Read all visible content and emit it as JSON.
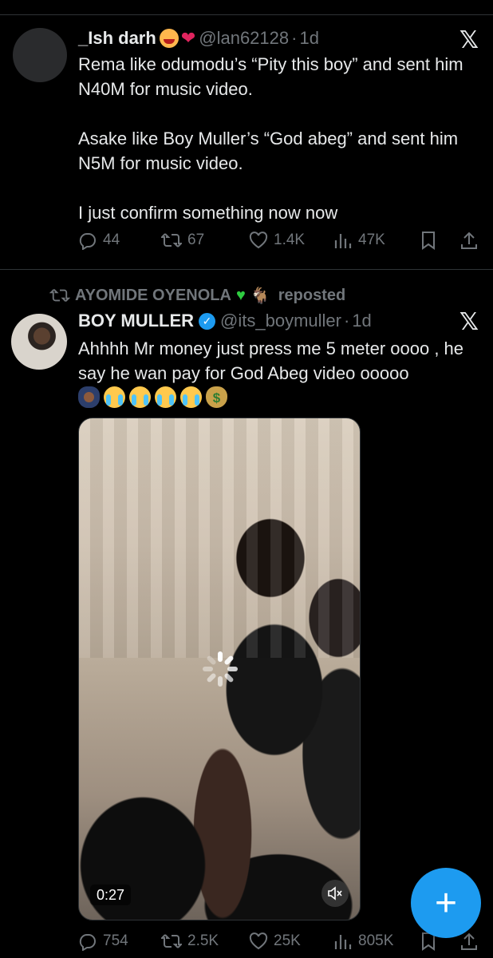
{
  "tweet1": {
    "display_name": "_Ish darh",
    "handle": "@lan62128",
    "separator": "·",
    "age": "1d",
    "x_logo": "𝕏",
    "paragraphs": [
      "Rema like odumodu’s “Pity this boy” and sent him N40M for music video.",
      "Asake like Boy Muller’s “God abeg” and sent him N5M for music video.",
      "I just confirm something now now"
    ],
    "stats": {
      "replies": "44",
      "reposts": "67",
      "likes": "1.4K",
      "views": "47K"
    }
  },
  "tweet2": {
    "repost_by": "AYOMIDE OYENOLA",
    "repost_emoji": "🐐",
    "repost_label": "reposted",
    "display_name": "BOY MULLER",
    "verified_mark": "✓",
    "handle": "@its_boymuller",
    "separator": "·",
    "age": "1d",
    "x_logo": "𝕏",
    "text": "Ahhhh Mr money just press me 5 meter oooo , he say he wan pay for God Abeg video ooooo",
    "emojis": [
      "pray-icon",
      "crying-face-icon",
      "crying-face-icon",
      "crying-face-icon",
      "crying-face-icon",
      "money-bag-icon"
    ],
    "money_bag_symbol": "$",
    "video": {
      "duration": "0:27",
      "muted": true
    },
    "stats": {
      "replies": "754",
      "reposts": "2.5K",
      "likes": "25K",
      "views": "805K"
    }
  },
  "fab": {
    "label": "+"
  },
  "colors": {
    "background": "#000000",
    "text": "#e7e9ea",
    "muted": "#71767b",
    "accent": "#1d9bf0",
    "divider": "#2f3336"
  }
}
